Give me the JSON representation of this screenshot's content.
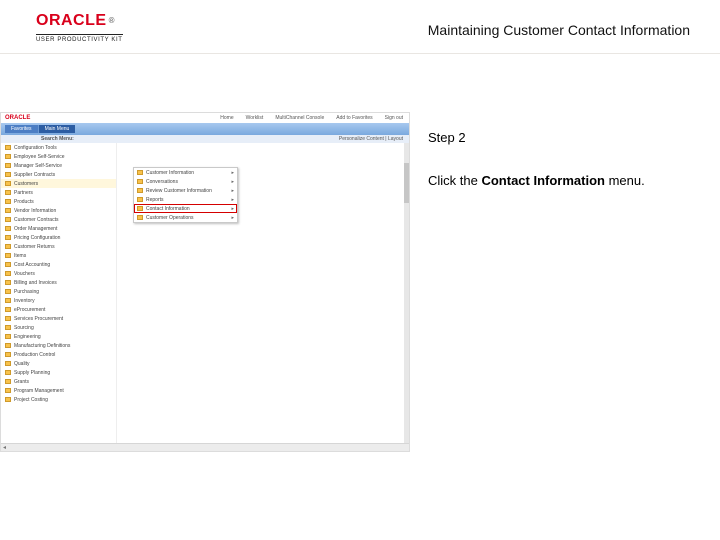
{
  "header": {
    "logo_text": "ORACLE",
    "logo_sub": "USER PRODUCTIVITY KIT",
    "title": "Maintaining Customer Contact Information"
  },
  "instruction": {
    "step_label": "Step 2",
    "line_prefix": "Click the ",
    "bold_target": "Contact Information",
    "line_suffix": " menu."
  },
  "screenshot": {
    "brand": "ORACLE",
    "tabs": [
      "Home",
      "Worklist",
      "MultiChannel Console",
      "Add to Favorites",
      "Sign out"
    ],
    "left_tab_1": "Favorites",
    "left_tab_2": "Main Menu",
    "search_label": "Search Menu:",
    "personalize": "Personalize Content | Layout",
    "sidebar_items": [
      "Configuration Tools",
      "Employee Self-Service",
      "Manager Self-Service",
      "Supplier Contracts",
      "Customers",
      "Partners",
      "Products",
      "Vendor Information",
      "Customer Contracts",
      "Order Management",
      "Pricing Configuration",
      "Customer Returns",
      "Items",
      "Cost Accounting",
      "Vouchers",
      "Billing and Invoices",
      "Purchasing",
      "Inventory",
      "eProcurement",
      "Services Procurement",
      "Sourcing",
      "Engineering",
      "Manufacturing Definitions",
      "Production Control",
      "Quality",
      "Supply Planning",
      "Grants",
      "Program Management",
      "Project Costing"
    ],
    "selected_sidebar_index": 4,
    "submenu_items": [
      "Customer Information",
      "Conversations",
      "Review Customer Information",
      "Reports",
      "Contact Information",
      "Customer Operations"
    ],
    "highlight_submenu_index": 4
  }
}
